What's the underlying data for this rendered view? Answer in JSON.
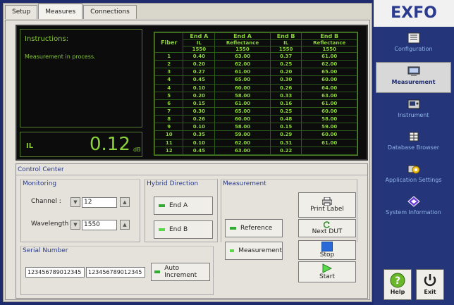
{
  "tabs": [
    "Setup",
    "Measures",
    "Connections"
  ],
  "display": {
    "instructions_title": "Instructions:",
    "instructions_text": "Measurement in process.",
    "il_label": "IL",
    "il_value": "0.12",
    "il_unit": "dB"
  },
  "table": {
    "col_groups": [
      "End A",
      "End A",
      "End B",
      "End B"
    ],
    "fiber_header": "Fiber",
    "sub_headers": [
      "IL",
      "Reflectance",
      "IL",
      "Reflectance"
    ],
    "wavelengths": [
      "1550",
      "1550",
      "1550",
      "1550"
    ],
    "rows": [
      [
        "1",
        "0.40",
        "63.00",
        "0.37",
        "61.00"
      ],
      [
        "2",
        "0.20",
        "62.00",
        "0.25",
        "62.00"
      ],
      [
        "3",
        "0.27",
        "61.00",
        "0.20",
        "65.00"
      ],
      [
        "4",
        "0.45",
        "65.00",
        "0.30",
        "60.00"
      ],
      [
        "4",
        "0.10",
        "60.00",
        "0.26",
        "64.00"
      ],
      [
        "5",
        "0.20",
        "58.00",
        "0.33",
        "63.00"
      ],
      [
        "6",
        "0.15",
        "61.00",
        "0.16",
        "61.00"
      ],
      [
        "7",
        "0.30",
        "65.00",
        "0.25",
        "60.00"
      ],
      [
        "8",
        "0.26",
        "60.00",
        "0.48",
        "58.00"
      ],
      [
        "9",
        "0.10",
        "58.00",
        "0.15",
        "59.00"
      ],
      [
        "10",
        "0.35",
        "59.00",
        "0.29",
        "60.00"
      ],
      [
        "11",
        "0.10",
        "62.00",
        "0.31",
        "61.00"
      ],
      [
        "12",
        "0.45",
        "63.00",
        "0.22",
        ""
      ]
    ]
  },
  "control": {
    "title": "Control Center",
    "monitoring": {
      "title": "Monitoring",
      "channel_label": "Channel :",
      "channel_value": "12",
      "wavelength_label": "Wavelength :",
      "wavelength_value": "1550"
    },
    "hybrid": {
      "title": "Hybrid Direction",
      "end_a": "End A",
      "end_b": "End B"
    },
    "measurement": {
      "title": "Measurement",
      "reference": "Reference",
      "measurement": "Measurement"
    },
    "serial": {
      "title": "Serial Number",
      "value1": "123456789012345",
      "value2": "123456789012345",
      "auto_increment": "Auto Increment"
    },
    "actions": {
      "print_label": "Print Label",
      "next_dut": "Next DUT",
      "stop": "Stop",
      "start": "Start"
    }
  },
  "sidebar": {
    "logo": "EXFO",
    "items": [
      "Configuration",
      "Measurement",
      "Instrument",
      "Database Browser",
      "Application Settings",
      "System Information"
    ],
    "help": "Help",
    "exit": "Exit"
  },
  "colors": {
    "display_green": "#8cd33a",
    "sidebar_bg": "#253579",
    "accent": "#2a3b8f"
  }
}
